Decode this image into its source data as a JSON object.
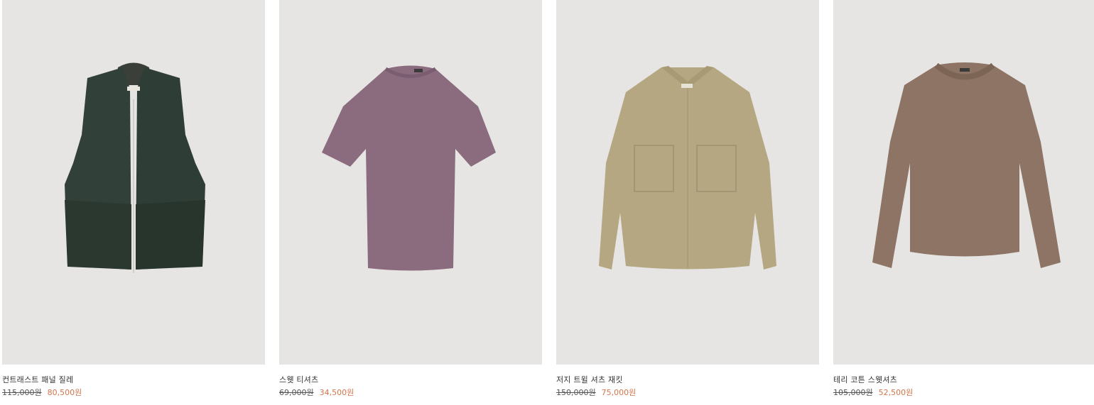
{
  "products": [
    {
      "name": "컨트래스트 패널 질레",
      "original_price": "115,000원",
      "sale_price": "80,500원",
      "image_icon": "vest-icon",
      "image_color": "#2f3f38"
    },
    {
      "name": "스웻 티셔츠",
      "original_price": "69,000원",
      "sale_price": "34,500원",
      "image_icon": "tshirt-icon",
      "image_color": "#8a6c7e"
    },
    {
      "name": "저지 트윌 셔츠 재킷",
      "original_price": "150,000원",
      "sale_price": "75,000원",
      "image_icon": "shirt-jacket-icon",
      "image_color": "#b5a781"
    },
    {
      "name": "테리 코튼 스웻셔츠",
      "original_price": "105,000원",
      "sale_price": "52,500원",
      "image_icon": "sweatshirt-icon",
      "image_color": "#8d7465"
    }
  ]
}
